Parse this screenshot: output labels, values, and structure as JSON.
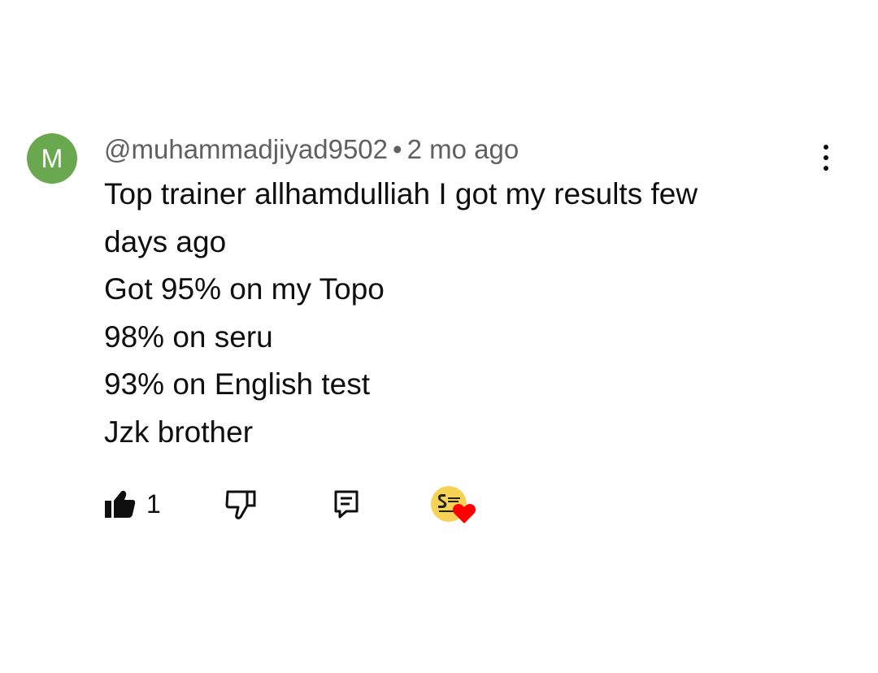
{
  "comment": {
    "avatar_letter": "M",
    "avatar_color": "#6aa84f",
    "username": "@muhammadjiyad9502",
    "separator": "•",
    "timestamp": "2 mo ago",
    "lines": [
      "Top trainer allhamdulliah I got my results few",
      "days ago",
      "Got 95% on my Topo",
      "98% on seru",
      "93% on English test",
      "Jzk brother"
    ],
    "like_count": "1",
    "icons": {
      "menu": "more-vert-icon",
      "like": "thumb-up-filled-icon",
      "dislike": "thumb-down-outline-icon",
      "reply": "comment-reply-icon",
      "creator_heart": "creator-heart-icon"
    },
    "heart_color": "#ff0000",
    "creator_avatar_color": "#f6d257"
  }
}
